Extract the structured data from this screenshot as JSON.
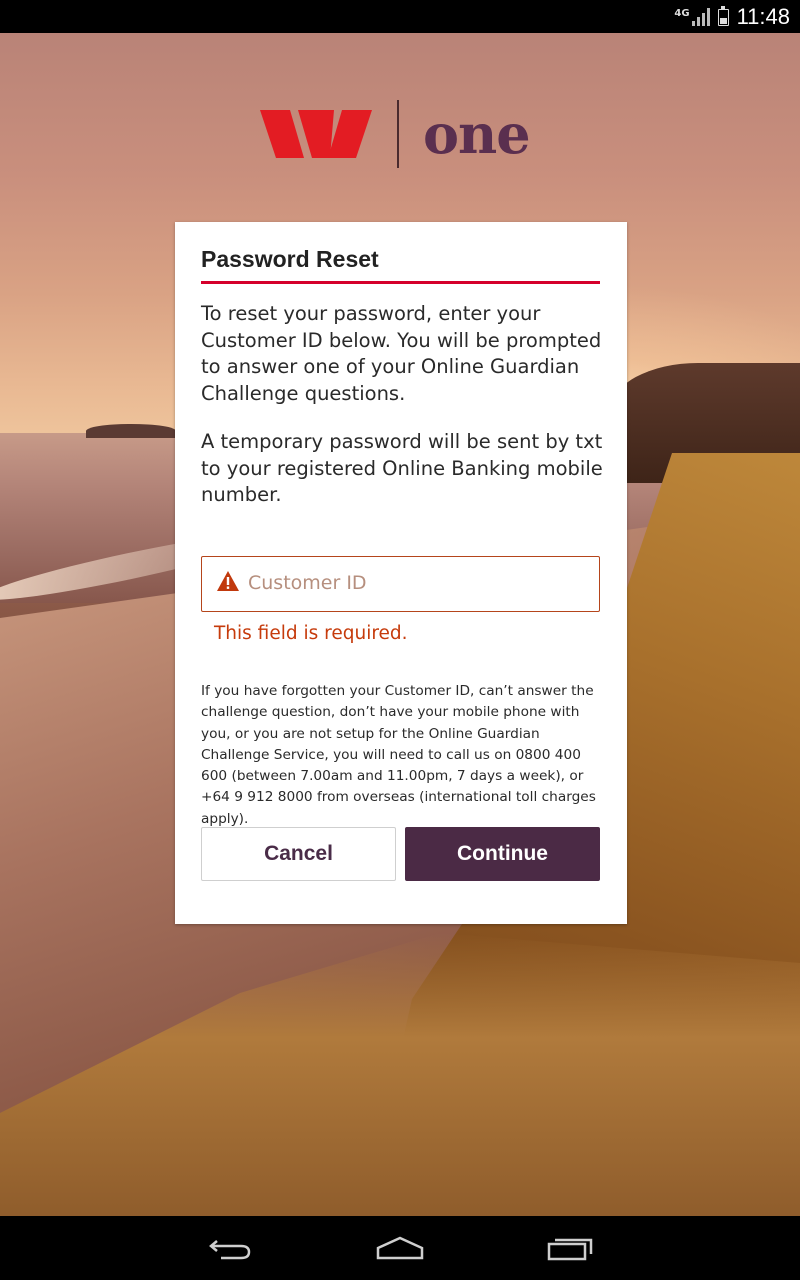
{
  "status_bar": {
    "network": "4G",
    "time": "11:48"
  },
  "logo": {
    "text": "one"
  },
  "card": {
    "title": "Password Reset",
    "intro": "To reset your password, enter your Customer ID below. You will be prompted to answer one of your Online Guardian Challenge questions.",
    "sms_note": "A temporary password will be sent by txt to your registered Online Banking mobile number.",
    "customer_id": {
      "value": "",
      "placeholder": "Customer ID",
      "error": "This field is required."
    },
    "help_text": "If you have forgotten your Customer ID, can’t answer the challenge question, don’t have your mobile phone with you, or you are not setup for the Online Guardian Challenge Service, you will need to call us on 0800 400 600 (between 7.00am and 11.00pm, 7 days a week), or +64 9 912 8000 from overseas (international toll charges apply).",
    "cancel_label": "Cancel",
    "continue_label": "Continue"
  },
  "colors": {
    "brand_red": "#d5002b",
    "brand_purple": "#4b2a45",
    "error": "#c63b0c"
  },
  "icons": {
    "field_warning": "warning-icon",
    "nav": [
      "back-icon",
      "home-icon",
      "recent-apps-icon"
    ]
  }
}
